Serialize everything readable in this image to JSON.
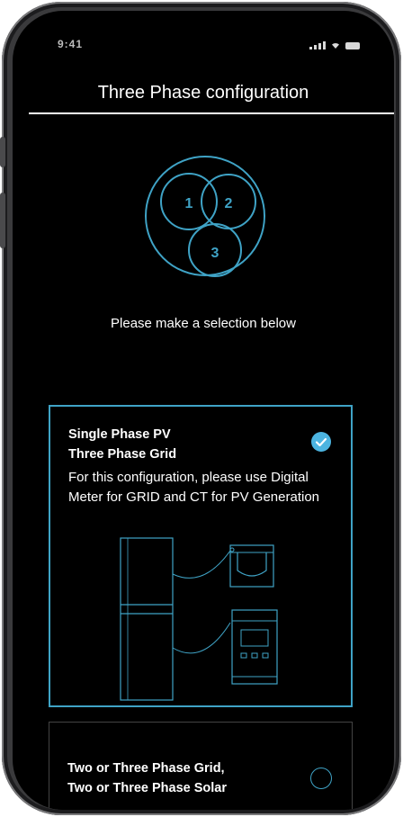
{
  "status_bar": {
    "time": "9:41"
  },
  "header": {
    "title": "Three Phase configuration"
  },
  "diagram": {
    "phases": [
      "1",
      "2",
      "3"
    ]
  },
  "prompt": "Please make a selection below",
  "options": [
    {
      "title_line1": "Single Phase PV",
      "title_line2": "Three Phase Grid",
      "description": "For this configuration, please use Digital Meter for GRID and CT for PV Generation",
      "selected": true
    },
    {
      "title_line1": "Two or Three Phase Grid,",
      "title_line2": "Two or Three Phase Solar",
      "selected": false
    }
  ],
  "colors": {
    "accent": "#3fa3c6",
    "check": "#4cb4e0",
    "background": "#000000"
  }
}
